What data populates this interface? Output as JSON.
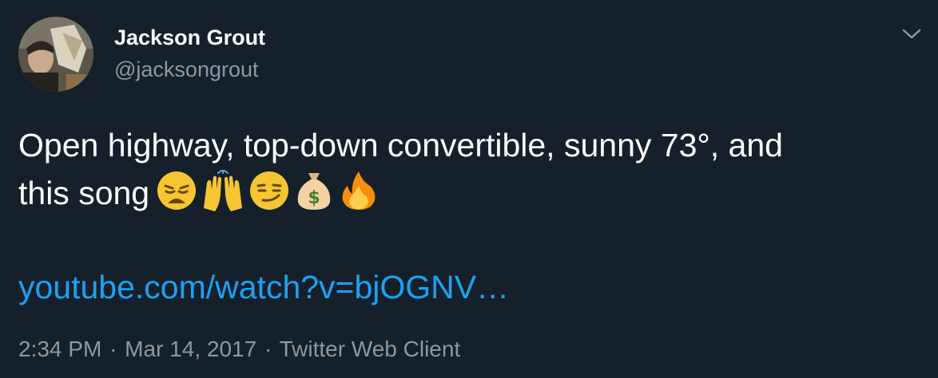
{
  "author": {
    "name": "Jackson Grout",
    "handle": "@jacksongrout"
  },
  "tweet": {
    "text_line1": "Open highway, top-down convertible, sunny 73°, and",
    "text_line2": "this song",
    "emojis": [
      "weary-face",
      "raising-hands",
      "smirking-face",
      "money-bag",
      "fire"
    ],
    "link_text": "youtube.com/watch?v=bjOGNV…"
  },
  "meta": {
    "time": "2:34 PM",
    "separator": "·",
    "date": "Mar 14, 2017",
    "client": "Twitter Web Client"
  },
  "colors": {
    "background": "#15202b",
    "primary_text": "#ffffff",
    "secondary_text": "#8899a6",
    "link": "#1da1f2"
  }
}
